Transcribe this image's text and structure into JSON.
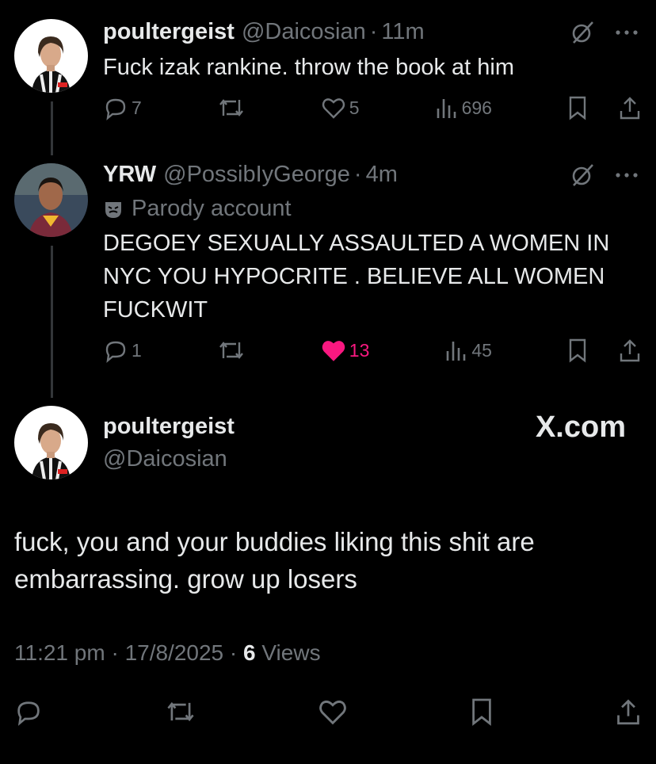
{
  "colors": {
    "background": "#000000",
    "text": "#e7e9ea",
    "muted": "#71767b",
    "like": "#f91880",
    "thread_line": "#333639"
  },
  "tweet1": {
    "name": "poultergeist",
    "handle": "@Daicosian",
    "time": "11m",
    "text": "Fuck izak rankine. throw the book at him",
    "replies": "7",
    "likes": "5",
    "views": "696",
    "icons": [
      "grok-icon",
      "more-icon",
      "reply-icon",
      "retweet-icon",
      "like-icon",
      "views-icon",
      "bookmark-icon",
      "share-icon"
    ]
  },
  "tweet2": {
    "name": "YRW",
    "handle": "@PossibIyGeorge",
    "time": "4m",
    "parody_label": "Parody account",
    "text": "DEGOEY SEXUALLY ASSAULTED A WOMEN IN NYC YOU HYPOCRITE . BELIEVE ALL WOMEN FUCKWIT",
    "replies": "1",
    "likes": "13",
    "liked": true,
    "views": "45"
  },
  "main": {
    "name": "poultergeist",
    "handle": "@Daicosian",
    "brand": "X.com",
    "text": "fuck, you and your buddies liking this shit are embarrassing. grow up losers",
    "time": "11:21 pm",
    "date": "17/8/2025",
    "views_count": "6",
    "views_label": "Views"
  },
  "separator": "·"
}
